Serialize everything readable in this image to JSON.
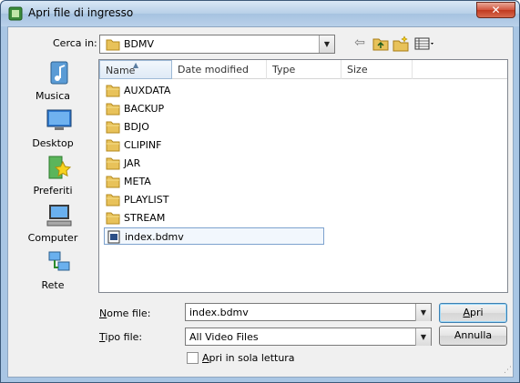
{
  "window": {
    "title": "Apri file di ingresso",
    "close_glyph": "✕"
  },
  "lookin": {
    "label": "Cerca in:",
    "value": "BDMV"
  },
  "toolbar": {
    "icons": [
      "back-arrow-icon",
      "up-folder-icon",
      "new-folder-icon",
      "view-menu-icon"
    ]
  },
  "places": [
    {
      "label": "Musica",
      "icon": "music-icon"
    },
    {
      "label": "Desktop",
      "icon": "desktop-icon"
    },
    {
      "label": "Preferiti",
      "icon": "favorites-icon"
    },
    {
      "label": "Computer",
      "icon": "computer-icon"
    },
    {
      "label": "Rete",
      "icon": "network-icon"
    }
  ],
  "columns": [
    "Name",
    "Date modified",
    "Type",
    "Size"
  ],
  "files": [
    {
      "name": "AUXDATA",
      "kind": "folder"
    },
    {
      "name": "BACKUP",
      "kind": "folder"
    },
    {
      "name": "BDJO",
      "kind": "folder"
    },
    {
      "name": "CLIPINF",
      "kind": "folder"
    },
    {
      "name": "JAR",
      "kind": "folder"
    },
    {
      "name": "META",
      "kind": "folder"
    },
    {
      "name": "PLAYLIST",
      "kind": "folder"
    },
    {
      "name": "STREAM",
      "kind": "folder"
    },
    {
      "name": "index.bdmv",
      "kind": "file",
      "selected": true
    }
  ],
  "filename": {
    "label_first": "N",
    "label_rest": "ome file:",
    "value": "index.bdmv"
  },
  "filetype": {
    "label_first": "T",
    "label_rest": "ipo file:",
    "value": "All Video Files"
  },
  "readonly": {
    "label_first": "A",
    "label_rest": "pri in sola lettura",
    "checked": false
  },
  "buttons": {
    "open_first": "A",
    "open_rest": "pri",
    "cancel": "Annulla"
  },
  "colors": {
    "titlebar": "#b7cfe8",
    "selection_border": "#7da2ce",
    "folder": "#e8c25a"
  }
}
